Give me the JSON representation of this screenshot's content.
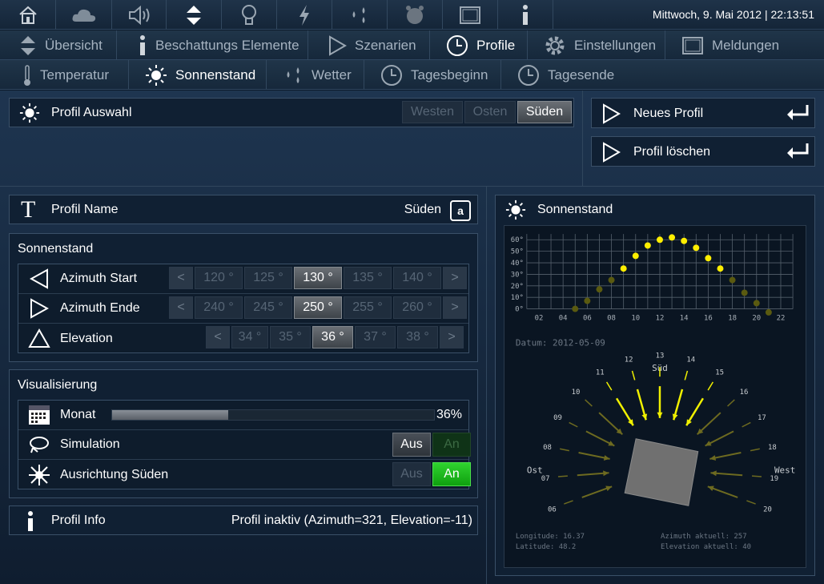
{
  "topbar": {
    "icons": [
      "home-icon",
      "cloud-icon",
      "speaker-icon",
      "up-down-icon",
      "bulb-icon",
      "lightning-icon",
      "drops-icon",
      "alarm-clock-icon",
      "window-icon",
      "info-icon"
    ],
    "datetime": "Mittwoch, 9. Mai 2012 | 22:13:51"
  },
  "nav1": [
    {
      "label": "Übersicht",
      "icon": "up-down-icon"
    },
    {
      "label": "Beschattungs Elemente",
      "icon": "info-icon"
    },
    {
      "label": "Szenarien",
      "icon": "play-icon"
    },
    {
      "label": "Profile",
      "icon": "clock-icon",
      "active": true
    },
    {
      "label": "Einstellungen",
      "icon": "gear-icon"
    },
    {
      "label": "Meldungen",
      "icon": "window-icon"
    }
  ],
  "nav2": [
    {
      "label": "Temperatur",
      "icon": "thermometer-icon"
    },
    {
      "label": "Sonnenstand",
      "icon": "sun-icon",
      "active": true
    },
    {
      "label": "Wetter",
      "icon": "drops-icon"
    },
    {
      "label": "Tagesbeginn",
      "icon": "clock-icon"
    },
    {
      "label": "Tagesende",
      "icon": "clock-icon"
    }
  ],
  "profil_auswahl": {
    "title": "Profil Auswahl",
    "options": [
      "Westen",
      "Osten",
      "Süden"
    ],
    "selected": "Süden"
  },
  "actions": {
    "new": "Neues Profil",
    "delete": "Profil löschen"
  },
  "profil_name": {
    "label": "Profil Name",
    "value": "Süden",
    "key_icon": "a"
  },
  "sonnenstand": {
    "title": "Sonnenstand",
    "azimuth_start": {
      "label": "Azimuth Start",
      "options": [
        "120 °",
        "125 °",
        "130 °",
        "135 °",
        "140 °"
      ],
      "selected": 2
    },
    "azimuth_ende": {
      "label": "Azimuth Ende",
      "options": [
        "240 °",
        "245 °",
        "250 °",
        "255 °",
        "260 °"
      ],
      "selected": 2
    },
    "elevation": {
      "label": "Elevation",
      "options": [
        "34 °",
        "35 °",
        "36 °",
        "37 °",
        "38 °"
      ],
      "selected": 2
    },
    "prev": "<",
    "next": ">"
  },
  "visualisierung": {
    "title": "Visualisierung",
    "monat": {
      "label": "Monat",
      "value": "36%",
      "progress": 0.36
    },
    "simulation": {
      "label": "Simulation",
      "aus": "Aus",
      "an": "An",
      "state": "aus"
    },
    "ausrichtung": {
      "label": "Ausrichtung Süden",
      "aus": "Aus",
      "an": "An",
      "state": "an"
    }
  },
  "profil_info": {
    "label": "Profil Info",
    "value": "Profil inaktiv (Azimuth=321, Elevation=-11)"
  },
  "chart_panel": {
    "title": "Sonnenstand"
  },
  "chart_data": {
    "type": "scatter",
    "x_ticks": [
      "02",
      "04",
      "06",
      "08",
      "10",
      "12",
      "14",
      "16",
      "18",
      "20",
      "22"
    ],
    "y_ticks": [
      "0°",
      "10°",
      "20°",
      "30°",
      "40°",
      "50°",
      "60°"
    ],
    "xlim": [
      1,
      23
    ],
    "ylim": [
      0,
      65
    ],
    "points": [
      [
        5,
        0
      ],
      [
        6,
        7
      ],
      [
        7,
        17
      ],
      [
        8,
        25
      ],
      [
        9,
        35
      ],
      [
        10,
        46
      ],
      [
        11,
        55
      ],
      [
        12,
        60
      ],
      [
        13,
        62
      ],
      [
        14,
        59
      ],
      [
        15,
        53
      ],
      [
        16,
        44
      ],
      [
        17,
        35
      ],
      [
        18,
        25
      ],
      [
        19,
        14
      ],
      [
        20,
        5
      ],
      [
        21,
        -3
      ]
    ],
    "datum": "Datum: 2012-05-09",
    "compass": {
      "south": "Süd",
      "east": "Ost",
      "west": "West"
    },
    "hours": [
      "06",
      "07",
      "08",
      "09",
      "10",
      "11",
      "12",
      "13",
      "14",
      "15",
      "16",
      "17",
      "18",
      "19",
      "20"
    ],
    "info": {
      "longitude": "Longitude: 16.37",
      "latitude": "Latitude: 48.2",
      "azimuth": "Azimuth aktuell: 257",
      "elevation": "Elevation aktuell: 40"
    },
    "colors": {
      "day": "#ffee00",
      "night": "#5a5a10",
      "arrow_active": "#f0f000",
      "arrow_inactive": "#6d6a20"
    }
  }
}
